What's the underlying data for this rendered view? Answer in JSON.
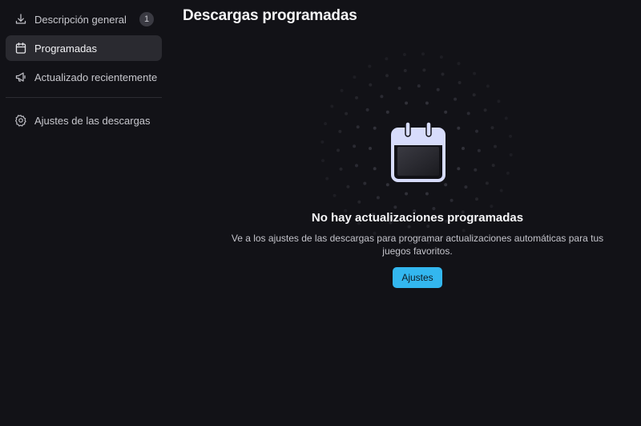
{
  "sidebar": {
    "items": [
      {
        "label": "Descripción general",
        "icon": "download-icon",
        "badge": "1",
        "active": false
      },
      {
        "label": "Programadas",
        "icon": "calendar-icon",
        "active": true
      },
      {
        "label": "Actualizado recientemente",
        "icon": "megaphone-icon",
        "active": false
      },
      {
        "label": "Ajustes de las descargas",
        "icon": "gear-icon",
        "active": false
      }
    ]
  },
  "main": {
    "title": "Descargas programadas",
    "empty_state": {
      "icon": "calendar-icon",
      "title": "No hay actualizaciones programadas",
      "description": "Ve a los ajustes de las descargas para programar actualizaciones automáticas para tus juegos favoritos.",
      "button_label": "Ajustes"
    }
  },
  "colors": {
    "background": "#121217",
    "active_item": "#2a2a30",
    "accent": "#33b7ef",
    "icon_outline": "#d7dcfb"
  }
}
